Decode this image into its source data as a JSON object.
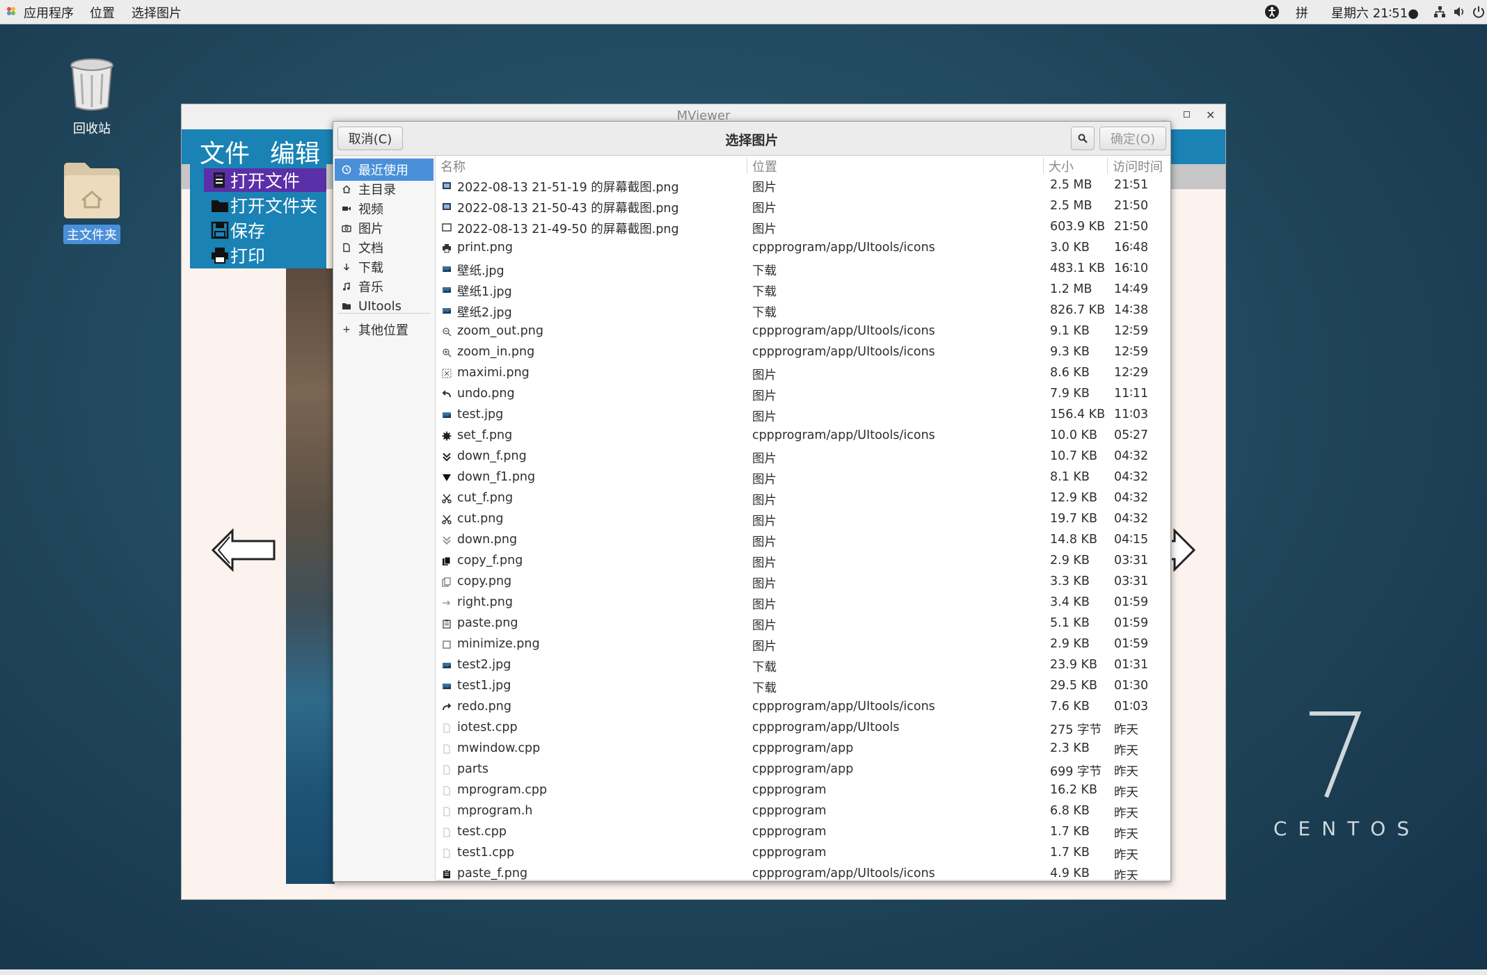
{
  "top_panel": {
    "menus": [
      "应用程序",
      "位置",
      "选择图片"
    ],
    "input_method": "拼",
    "datetime": "星期六 21∶51●"
  },
  "desktop": {
    "trash_label": "回收站",
    "home_label": "主文件夹",
    "logo_text": "CENTOS"
  },
  "mviewer": {
    "title": "MViewer",
    "menus": [
      "文件",
      "编辑"
    ],
    "file_menu": [
      "打开文件",
      "打开文件夹",
      "保存",
      "打印"
    ]
  },
  "dialog": {
    "title": "选择图片",
    "cancel": "取消(C)",
    "confirm": "确定(O)",
    "sidebar": [
      "最近使用",
      "主目录",
      "视频",
      "图片",
      "文档",
      "下载",
      "音乐",
      "UItools"
    ],
    "sidebar_other": "其他位置",
    "columns": {
      "name": "名称",
      "location": "位置",
      "size": "大小",
      "time": "访问时间"
    },
    "files": [
      {
        "icon": "image-icon",
        "name": "2022-08-13 21-51-19 的屏幕截图.png",
        "location": "图片",
        "size": "2.5 MB",
        "time": "21∶51"
      },
      {
        "icon": "image-icon",
        "name": "2022-08-13 21-50-43 的屏幕截图.png",
        "location": "图片",
        "size": "2.5 MB",
        "time": "21∶50"
      },
      {
        "icon": "window-icon",
        "name": "2022-08-13 21-49-50 的屏幕截图.png",
        "location": "图片",
        "size": "603.9 KB",
        "time": "21∶50"
      },
      {
        "icon": "printer-icon",
        "name": "print.png",
        "location": "cppprogram/app/UItools/icons",
        "size": "3.0 KB",
        "time": "16∶48"
      },
      {
        "icon": "photo-icon",
        "name": "壁纸.jpg",
        "location": "下载",
        "size": "483.1 KB",
        "time": "16∶10"
      },
      {
        "icon": "photo-icon",
        "name": "壁纸1.jpg",
        "location": "下载",
        "size": "1.2 MB",
        "time": "14∶49"
      },
      {
        "icon": "photo-icon",
        "name": "壁纸2.jpg",
        "location": "下载",
        "size": "826.7 KB",
        "time": "14∶38"
      },
      {
        "icon": "zoom-out-icon",
        "name": "zoom_out.png",
        "location": "cppprogram/app/UItools/icons",
        "size": "9.1 KB",
        "time": "12∶59"
      },
      {
        "icon": "zoom-in-icon",
        "name": "zoom_in.png",
        "location": "cppprogram/app/UItools/icons",
        "size": "9.3 KB",
        "time": "12∶59"
      },
      {
        "icon": "maximize-icon",
        "name": "maximi.png",
        "location": "图片",
        "size": "8.6 KB",
        "time": "12∶29"
      },
      {
        "icon": "undo-icon",
        "name": "undo.png",
        "location": "图片",
        "size": "7.9 KB",
        "time": "11∶11"
      },
      {
        "icon": "photo-icon",
        "name": "test.jpg",
        "location": "图片",
        "size": "156.4 KB",
        "time": "11∶03"
      },
      {
        "icon": "gear-icon",
        "name": "set_f.png",
        "location": "cppprogram/app/UItools/icons",
        "size": "10.0 KB",
        "time": "05∶27"
      },
      {
        "icon": "double-chevron-down-icon",
        "name": "down_f.png",
        "location": "图片",
        "size": "10.7 KB",
        "time": "04∶32"
      },
      {
        "icon": "triangle-down-icon",
        "name": "down_f1.png",
        "location": "图片",
        "size": "8.1 KB",
        "time": "04∶32"
      },
      {
        "icon": "scissors-icon",
        "name": "cut_f.png",
        "location": "图片",
        "size": "12.9 KB",
        "time": "04∶32"
      },
      {
        "icon": "scissors-icon",
        "name": "cut.png",
        "location": "图片",
        "size": "19.7 KB",
        "time": "04∶32"
      },
      {
        "icon": "double-chevron-down-light-icon",
        "name": "down.png",
        "location": "图片",
        "size": "14.8 KB",
        "time": "04∶15"
      },
      {
        "icon": "copy-filled-icon",
        "name": "copy_f.png",
        "location": "图片",
        "size": "2.9 KB",
        "time": "03∶31"
      },
      {
        "icon": "copy-icon",
        "name": "copy.png",
        "location": "图片",
        "size": "3.3 KB",
        "time": "03∶31"
      },
      {
        "icon": "arrow-right-icon",
        "name": "right.png",
        "location": "图片",
        "size": "3.4 KB",
        "time": "01∶59"
      },
      {
        "icon": "clipboard-icon",
        "name": "paste.png",
        "location": "图片",
        "size": "5.1 KB",
        "time": "01∶59"
      },
      {
        "icon": "square-icon",
        "name": "minimize.png",
        "location": "图片",
        "size": "2.9 KB",
        "time": "01∶59"
      },
      {
        "icon": "photo-icon",
        "name": "test2.jpg",
        "location": "下载",
        "size": "23.9 KB",
        "time": "01∶31"
      },
      {
        "icon": "photo-icon",
        "name": "test1.jpg",
        "location": "下载",
        "size": "29.5 KB",
        "time": "01∶30"
      },
      {
        "icon": "redo-icon",
        "name": "redo.png",
        "location": "cppprogram/app/UItools/icons",
        "size": "7.6 KB",
        "time": "01∶03"
      },
      {
        "icon": "text-file-icon",
        "name": "iotest.cpp",
        "location": "cppprogram/app/UItools",
        "size": "275 字节",
        "time": "昨天"
      },
      {
        "icon": "text-file-icon",
        "name": "mwindow.cpp",
        "location": "cppprogram/app",
        "size": "2.3 KB",
        "time": "昨天"
      },
      {
        "icon": "text-file-icon",
        "name": "parts",
        "location": "cppprogram/app",
        "size": "699 字节",
        "time": "昨天"
      },
      {
        "icon": "text-file-icon",
        "name": "mprogram.cpp",
        "location": "cppprogram",
        "size": "16.2 KB",
        "time": "昨天"
      },
      {
        "icon": "text-file-icon",
        "name": "mprogram.h",
        "location": "cppprogram",
        "size": "6.8 KB",
        "time": "昨天"
      },
      {
        "icon": "text-file-icon",
        "name": "test.cpp",
        "location": "cppprogram",
        "size": "1.7 KB",
        "time": "昨天"
      },
      {
        "icon": "text-file-icon",
        "name": "test1.cpp",
        "location": "cppprogram",
        "size": "1.7 KB",
        "time": "昨天"
      },
      {
        "icon": "clipboard-filled-icon",
        "name": "paste_f.png",
        "location": "cppprogram/app/UItools/icons",
        "size": "4.9 KB",
        "time": "昨天"
      }
    ]
  },
  "colors": {
    "accent": "#4a90d9",
    "app_menubar": "#1a82b4",
    "file_menu_highlight": "#5b2fa8"
  }
}
